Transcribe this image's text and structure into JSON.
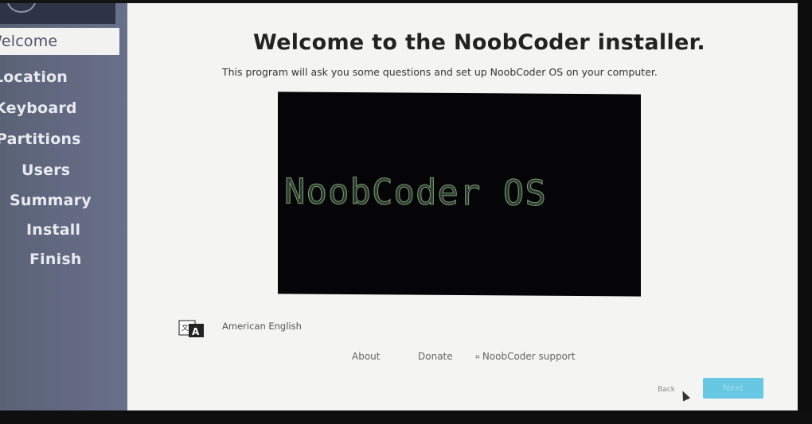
{
  "sidebar": {
    "steps": [
      {
        "label": "Welcome",
        "active": true
      },
      {
        "label": "Location"
      },
      {
        "label": "Keyboard"
      },
      {
        "label": "Partitions"
      },
      {
        "label": "Users"
      },
      {
        "label": "Summary"
      },
      {
        "label": "Install"
      },
      {
        "label": "Finish"
      }
    ]
  },
  "main": {
    "title": "Welcome to the NoobCoder installer.",
    "subtitle": "This program will ask you some questions and set up NoobCoder OS on your computer.",
    "banner_text": "NoobCoder OS",
    "language": "American English",
    "links": {
      "about": "About",
      "donate": "Donate",
      "support": "NoobCoder support"
    }
  },
  "footer": {
    "back_label": "Back",
    "next_label": "Next"
  },
  "icons": {
    "language": "language-icon",
    "support": "support-icon"
  },
  "colors": {
    "sidebar": "#646b80",
    "active_step_bg": "#f2f2f0",
    "next_button": "#68c7e2",
    "banner_bg": "#050508",
    "banner_text": "#7d9c78"
  }
}
